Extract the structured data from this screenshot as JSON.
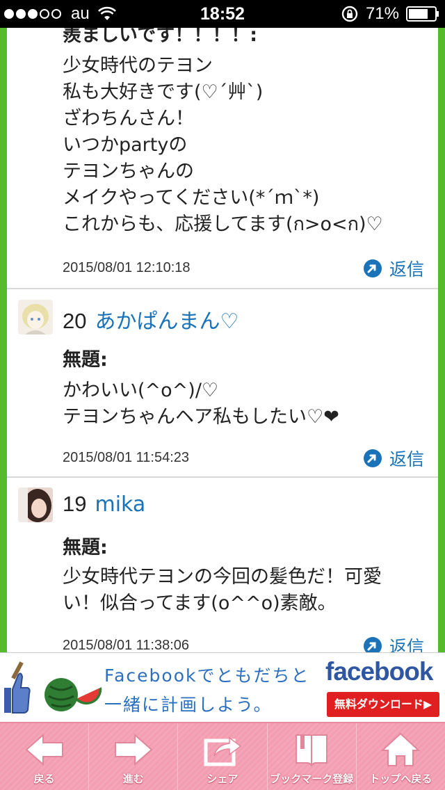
{
  "status_bar": {
    "carrier": "au",
    "time": "18:52",
    "battery": "71%"
  },
  "comments": [
    {
      "subject": "羨ましいです！！！！:",
      "body": "少女時代のテヨン\n私も大好きです(♡´艸`)\nざわちんさん！\nいつかpartyの\nテヨンちゃんの\nメイクやってください(*´ｍ`*)\nこれからも、応援してます(ก>o<ก)♡",
      "date": "2015/08/01 12:10:18",
      "reply_label": "返信"
    },
    {
      "number": "20",
      "name": "あかぱんまん♡",
      "subject": "無題:",
      "body": "かわいい(^o^)/♡\nテヨンちゃんヘア私もしたい♡❤",
      "date": "2015/08/01 11:54:23",
      "reply_label": "返信"
    },
    {
      "number": "19",
      "name": "mika",
      "subject": "無題:",
      "body": "少女時代テヨンの今回の髪色だ！可愛\nい！似合ってます(o^^o)素敵。",
      "date": "2015/08/01 11:38:06",
      "reply_label": "返信"
    }
  ],
  "ad": {
    "text": "Facebookでともだちと\n一緒に計画しよう。",
    "logo": "facebook",
    "cta": "無料ダウンロード▶"
  },
  "toolbar": {
    "items": [
      {
        "label": "戻る",
        "icon": "back-arrow-icon"
      },
      {
        "label": "進む",
        "icon": "forward-arrow-icon"
      },
      {
        "label": "シェア",
        "icon": "share-icon"
      },
      {
        "label": "ブックマーク登録",
        "icon": "bookmark-book-icon"
      },
      {
        "label": "トップへ戻る",
        "icon": "home-icon"
      }
    ]
  },
  "colors": {
    "frame_green": "#55bb2d",
    "link_blue": "#1a73b8",
    "toolbar_pink": "#f49cb0",
    "ad_red": "#e02020",
    "facebook_blue": "#2f56a0"
  }
}
